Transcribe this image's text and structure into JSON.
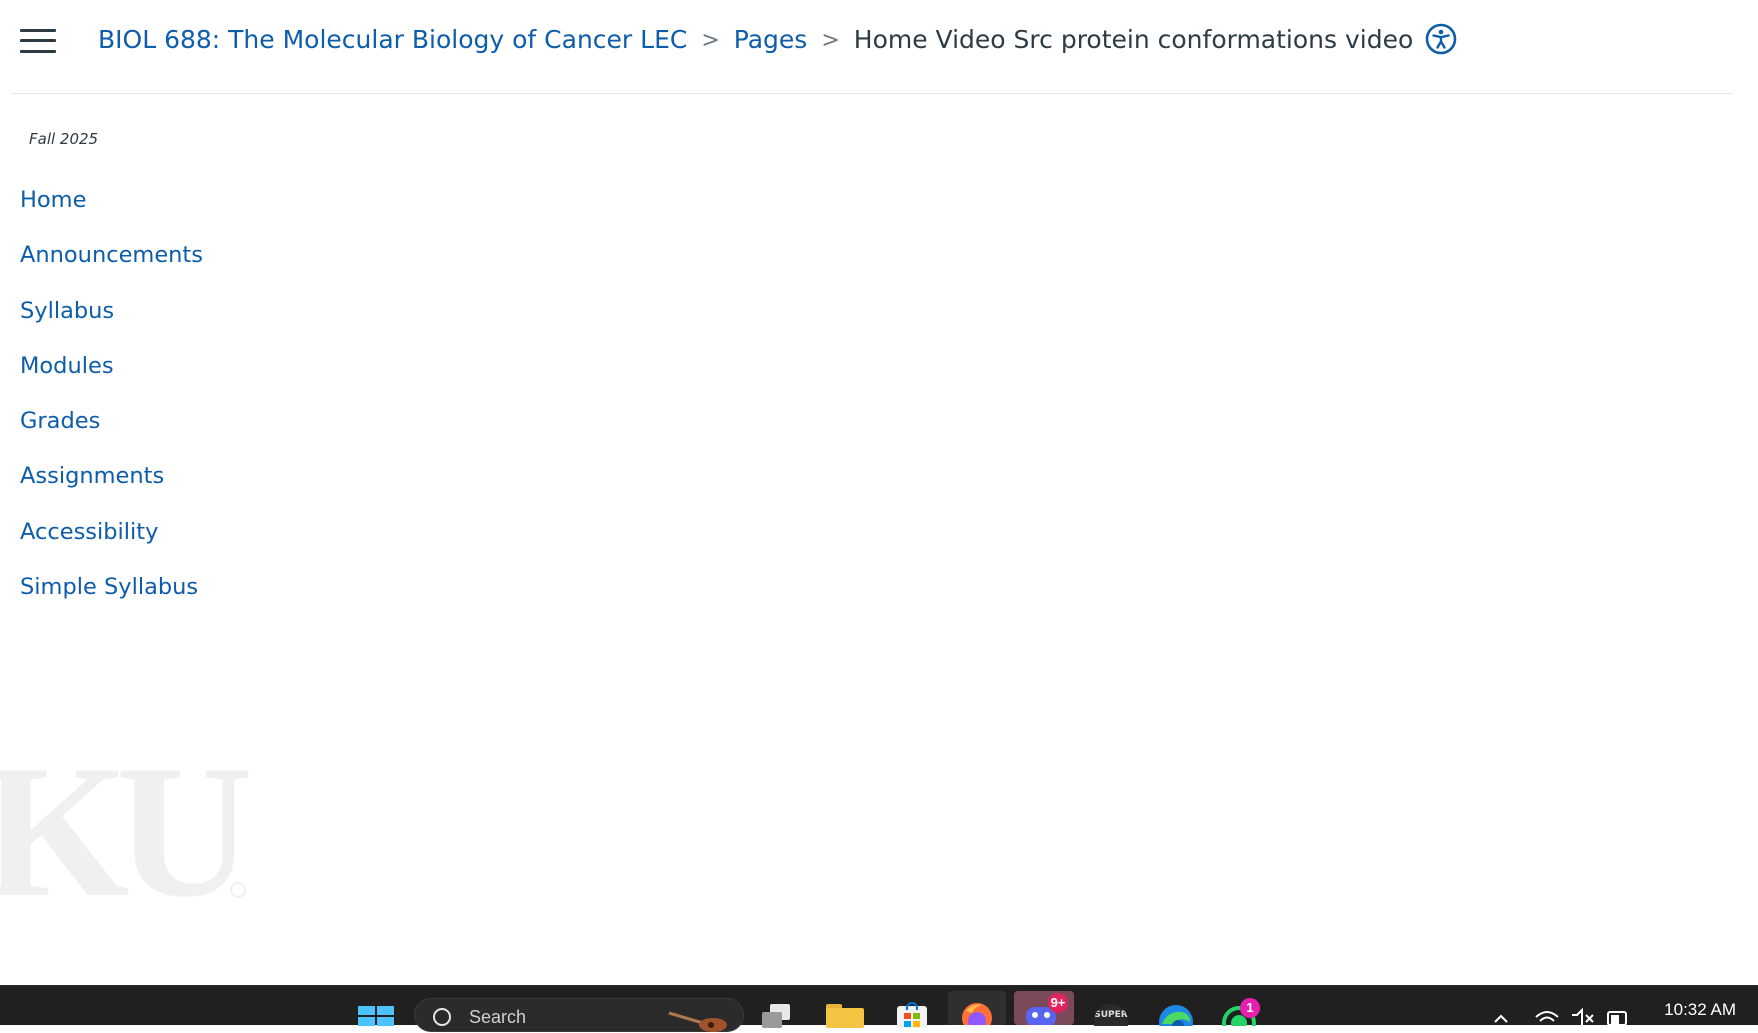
{
  "breadcrumb": {
    "course": "BIOL 688: The Molecular Biology of Cancer LEC",
    "section": "Pages",
    "current": "Home Video Src protein conformations video",
    "separator": ">"
  },
  "sidebar": {
    "term": "Fall 2025",
    "items": [
      {
        "label": "Home"
      },
      {
        "label": "Announcements"
      },
      {
        "label": "Syllabus"
      },
      {
        "label": "Modules"
      },
      {
        "label": "Grades"
      },
      {
        "label": "Assignments"
      },
      {
        "label": "Accessibility"
      },
      {
        "label": "Simple Syllabus"
      }
    ]
  },
  "logo": {
    "text": "KU"
  },
  "taskbar": {
    "search_placeholder": "Search",
    "discord_badge": "9+",
    "whatsapp_badge": "1",
    "clock": "10:32 AM",
    "super_label": "SUPER"
  },
  "colors": {
    "link": "#0d5dab",
    "text": "#2d3b45",
    "taskbar_bg": "#202020",
    "accent_blue": "#4cc2ff"
  },
  "icons": {
    "menu": "hamburger-icon",
    "accessibility": "accessibility-icon",
    "windows": "windows-start-icon",
    "search": "search-icon",
    "files": "file-explorer-icon",
    "store": "microsoft-store-icon",
    "firefox": "firefox-icon",
    "discord": "discord-icon",
    "edge": "edge-icon",
    "whatsapp": "whatsapp-icon"
  }
}
